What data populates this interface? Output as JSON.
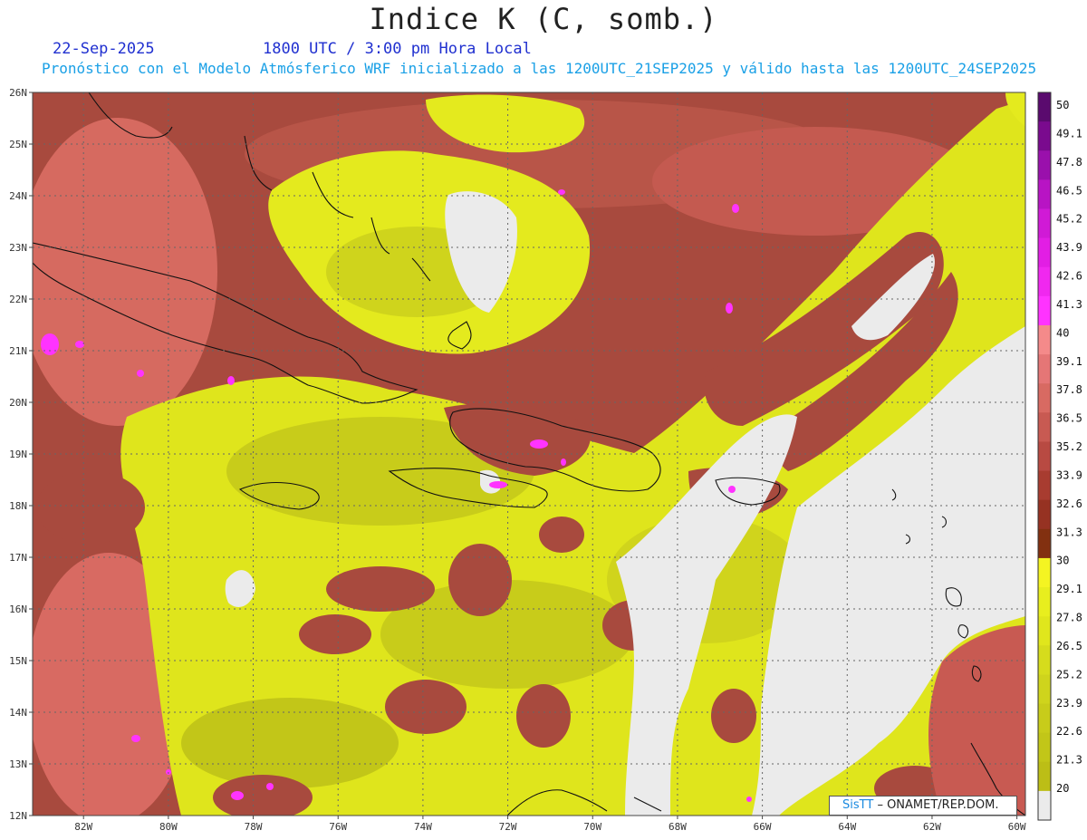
{
  "header": {
    "title": "Indice K (C, somb.)",
    "date": "22-Sep-2025",
    "time": "1800 UTC / 3:00 pm Hora Local",
    "description": "Pronóstico con el Modelo Atmósferico WRF inicializado a las 1200UTC_21SEP2025 y válido hasta las  1200UTC_24SEP2025"
  },
  "map": {
    "lat_labels": [
      "26N",
      "25N",
      "24N",
      "23N",
      "22N",
      "21N",
      "20N",
      "19N",
      "18N",
      "17N",
      "16N",
      "15N",
      "14N",
      "13N",
      "12N"
    ],
    "lon_labels": [
      "82W",
      "80W",
      "78W",
      "76W",
      "74W",
      "72W",
      "70W",
      "68W",
      "66W",
      "64W",
      "62W",
      "60W"
    ],
    "lat_range": [
      12,
      26
    ],
    "lon_range": [
      -83.2,
      -59.8
    ]
  },
  "colorbar": {
    "labels": [
      "50",
      "49.1",
      "47.8",
      "46.5",
      "45.2",
      "43.9",
      "42.6",
      "41.3",
      "40",
      "39.1",
      "37.8",
      "36.5",
      "35.2",
      "33.9",
      "32.6",
      "31.3",
      "30",
      "29.1",
      "27.8",
      "26.5",
      "25.2",
      "23.9",
      "22.6",
      "21.3",
      "20"
    ],
    "colors": {
      "over_40": [
        "#5a0a6e",
        "#7a0a8e",
        "#9a10ac",
        "#b814c4",
        "#d01ad6",
        "#e21ee4",
        "#f028ef",
        "#ff33ff"
      ],
      "band_30_40": [
        "#f48a8a",
        "#e57676",
        "#d86a62",
        "#c85a52",
        "#b84a42",
        "#a83c30",
        "#963222",
        "#823010"
      ],
      "band_20_30": [
        "#f4f422",
        "#e8ee1e",
        "#e0e61c",
        "#d6dc1c",
        "#cfd41c",
        "#c8cc1a",
        "#c2c618",
        "#bcbe16"
      ],
      "below_20": "#ebebeb"
    }
  },
  "credit": {
    "brand": "SisTT",
    "org": "–  ONAMET/REP.DOM."
  }
}
